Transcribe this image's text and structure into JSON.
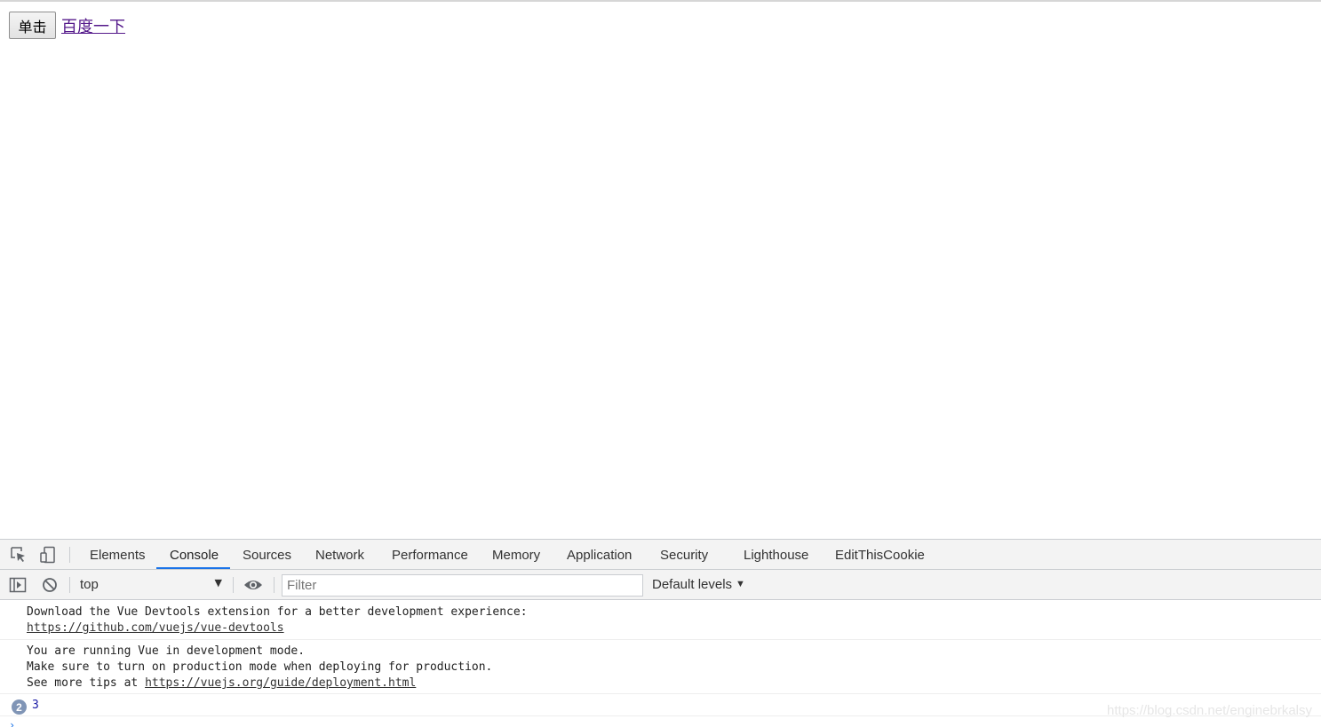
{
  "page": {
    "button_label": "单击",
    "link_text": "百度一下"
  },
  "devtools": {
    "icons": [
      "inspect-element-icon",
      "device-toolbar-icon",
      "sidebar-toggle-icon",
      "clear-console-icon",
      "eye-icon"
    ],
    "tabs": [
      {
        "label": "Elements"
      },
      {
        "label": "Console"
      },
      {
        "label": "Sources"
      },
      {
        "label": "Network"
      },
      {
        "label": "Performance"
      },
      {
        "label": "Memory"
      },
      {
        "label": "Application"
      },
      {
        "label": "Security"
      },
      {
        "label": "Lighthouse"
      },
      {
        "label": "EditThisCookie"
      }
    ],
    "active_tab": "Console",
    "toolbar": {
      "context": "top",
      "filter_placeholder": "Filter",
      "levels": "Default levels"
    },
    "console": {
      "messages": [
        {
          "text": "Download the Vue Devtools extension for a better development experience:",
          "link": "https://github.com/vuejs/vue-devtools"
        },
        {
          "line1": "You are running Vue in development mode.",
          "line2": "Make sure to turn on production mode when deploying for production.",
          "line3_prefix": "See more tips at ",
          "link": "https://vuejs.org/guide/deployment.html"
        },
        {
          "repeat_count": "2",
          "value": "3"
        }
      ],
      "prompt": "›"
    },
    "accent_color": "#1a73e8"
  },
  "watermark": "https://blog.csdn.net/enginebrkalsy"
}
